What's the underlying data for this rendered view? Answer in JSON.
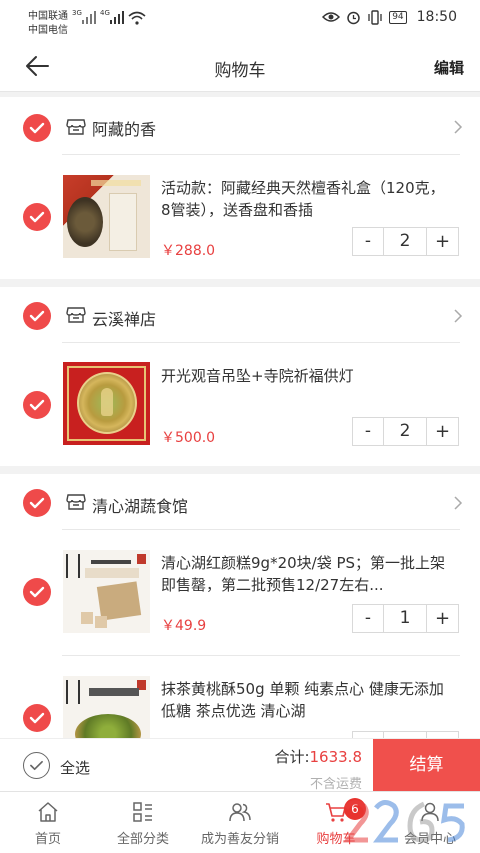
{
  "status_bar": {
    "carrier1": "中国联通",
    "carrier2": "中国电信",
    "net1": "3G",
    "net2": "4G",
    "battery": "94",
    "time": "18:50"
  },
  "nav": {
    "title": "购物车",
    "edit": "编辑"
  },
  "shops": [
    {
      "name": "阿藏的香",
      "items": [
        {
          "title": "活动款：阿藏经典天然檀香礼盒（120克，8管装），送香盘和香插",
          "price": "￥288.0",
          "qty": "2",
          "minus": "-",
          "plus": "+"
        }
      ]
    },
    {
      "name": "云溪禅店",
      "items": [
        {
          "title": "开光观音吊坠+寺院祈福供灯",
          "price": "￥500.0",
          "qty": "2",
          "minus": "-",
          "plus": "+"
        }
      ]
    },
    {
      "name": "清心湖蔬食馆",
      "items": [
        {
          "title": "清心湖红颜糕9g*20块/袋 PS；第一批上架即售罄，第二批预售12/27左右...",
          "price": "￥49.9",
          "qty": "1",
          "minus": "-",
          "plus": "+"
        },
        {
          "title": "抹茶黄桃酥50g 单颗 纯素点心 健康无添加 低糖 茶点优选 清心湖",
          "price": "",
          "qty": "",
          "minus": "-",
          "plus": "+"
        }
      ]
    }
  ],
  "footer": {
    "select_all": "全选",
    "total_label": "合计:",
    "total_value": "1633.8",
    "shipping_note": "不含运费",
    "checkout": "结算"
  },
  "tabs": [
    {
      "label": "首页",
      "icon": "home-icon"
    },
    {
      "label": "全部分类",
      "icon": "category-icon"
    },
    {
      "label": "成为善友分销",
      "icon": "users-icon"
    },
    {
      "label": "购物车",
      "icon": "cart-icon",
      "badge": "6"
    },
    {
      "label": "会员中心",
      "icon": "user-icon"
    }
  ],
  "colors": {
    "accent": "#ef4a4a",
    "price": "#e84040",
    "checkout_bg": "#f0504c"
  }
}
